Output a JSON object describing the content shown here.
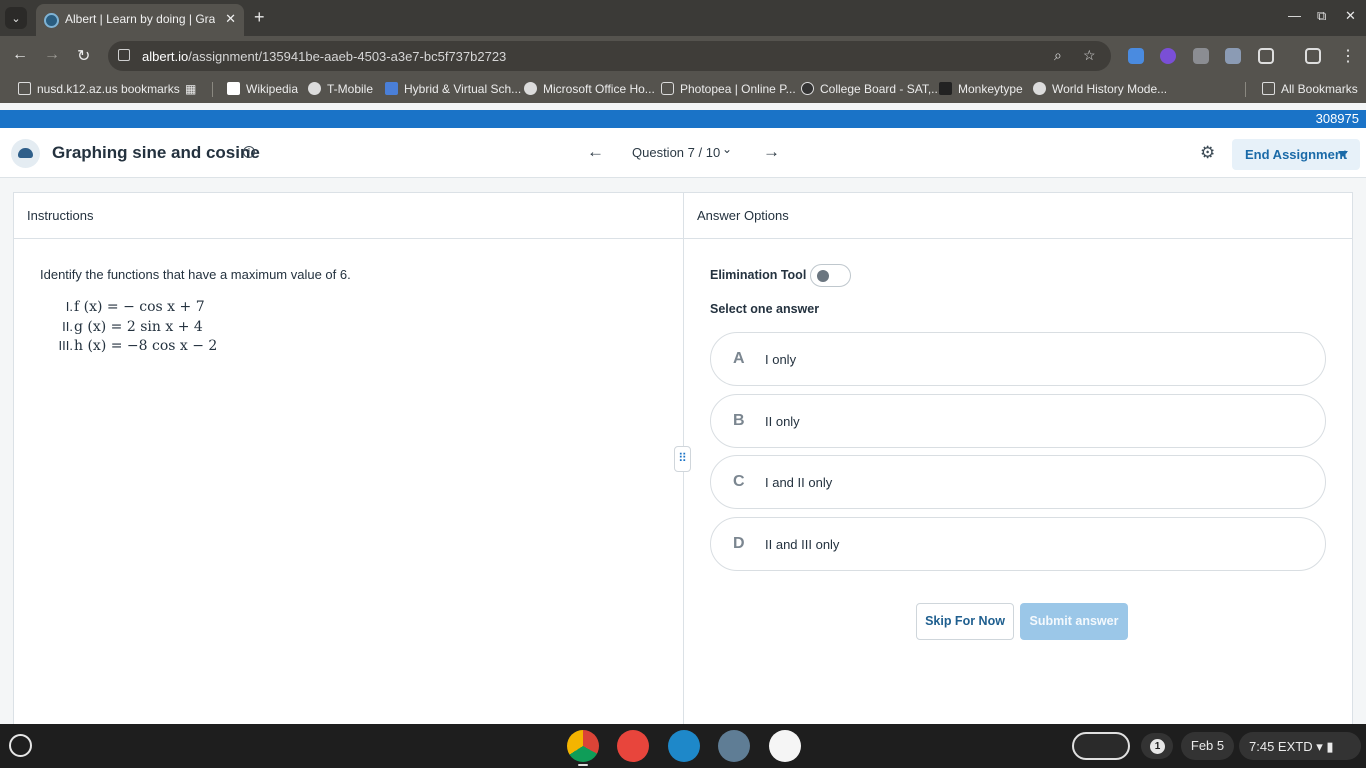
{
  "browser": {
    "tab_title": "Albert | Learn by doing | Grades",
    "url_domain": "albert.io",
    "url_path": "/assignment/135941be-aaeb-4503-a3e7-bc5f737b2723"
  },
  "bookmarks": [
    {
      "label": "nusd.k12.az.us bookmarks"
    },
    {
      "label": "Wikipedia"
    },
    {
      "label": "T-Mobile"
    },
    {
      "label": "Hybrid & Virtual Sch..."
    },
    {
      "label": "Microsoft Office Ho..."
    },
    {
      "label": "Photopea | Online P..."
    },
    {
      "label": "College Board - SAT,..."
    },
    {
      "label": "Monkeytype"
    },
    {
      "label": "World History Mode..."
    }
  ],
  "all_bookmarks": "All Bookmarks",
  "top_bar": {
    "id_number": "308975"
  },
  "header": {
    "title": "Graphing sine and cosine",
    "question_label": "Question 7 / 10",
    "end_button": "End Assignment"
  },
  "instructions": {
    "heading": "Instructions",
    "prompt": "Identify the functions that have a maximum value of 6.",
    "functions": [
      {
        "num": "I.",
        "expr": "f (x) = − cos x + 7"
      },
      {
        "num": "II.",
        "expr": "g (x) = 2 sin x + 4"
      },
      {
        "num": "III.",
        "expr": "h (x) = −8 cos x − 2"
      }
    ]
  },
  "answers": {
    "heading": "Answer Options",
    "elimination_label": "Elimination Tool",
    "elimination_on": false,
    "select_label": "Select one answer",
    "options": [
      {
        "letter": "A",
        "text": "I only"
      },
      {
        "letter": "B",
        "text": "II only"
      },
      {
        "letter": "C",
        "text": "I and II only"
      },
      {
        "letter": "D",
        "text": "II and III only"
      }
    ],
    "skip_label": "Skip For Now",
    "submit_label": "Submit answer"
  },
  "taskbar": {
    "badge_count": "1",
    "date": "Feb 5",
    "time": "7:45 EXTD"
  },
  "colors": {
    "accent": "#1a73c7",
    "submit_disabled": "#9bc7e8"
  }
}
